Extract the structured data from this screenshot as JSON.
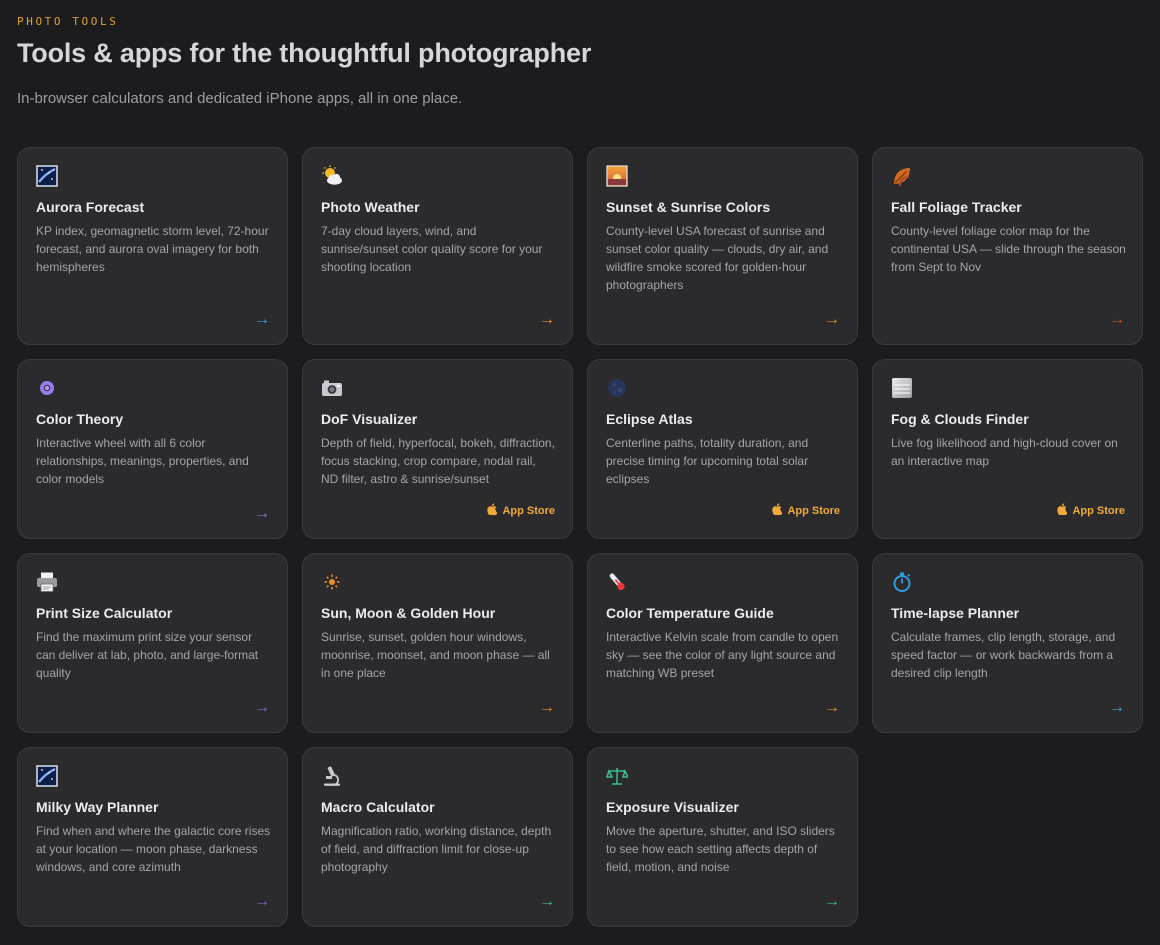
{
  "header": {
    "eyebrow": "PHOTO TOOLS",
    "title": "Tools & apps for the thoughtful photographer",
    "subtitle": "In-browser calculators and dedicated iPhone apps, all in one place."
  },
  "colors": {
    "accent": "#e0a030",
    "background": "#1c1c1e",
    "card": "#2b2b2e",
    "app_store": "#f0a93a"
  },
  "cards": [
    {
      "title": "Aurora Forecast",
      "description": "KP index, geomagnetic storm level, 72-hour forecast, and aurora oval imagery for both hemispheres",
      "icon": "night-sky-icon",
      "action": "arrow",
      "arrow": "→",
      "arrow_color": "#37a8d8"
    },
    {
      "title": "Photo Weather",
      "description": "7-day cloud layers, wind, and sunrise/sunset color quality score for your shooting location",
      "icon": "sun-behind-cloud-icon",
      "action": "arrow",
      "arrow": "→",
      "arrow_color": "#e8892a"
    },
    {
      "title": "Sunset & Sunrise Colors",
      "description": "County-level USA forecast of sunrise and sunset color quality — clouds, dry air, and wildfire smoke scored for golden-hour photographers",
      "icon": "sunset-picture-icon",
      "action": "arrow",
      "arrow": "→",
      "arrow_color": "#e8892a"
    },
    {
      "title": "Fall Foliage Tracker",
      "description": "County-level foliage color map for the continental USA — slide through the season from Sept to Nov",
      "icon": "fallen-leaf-icon",
      "action": "arrow",
      "arrow": "→",
      "arrow_color": "#c9502a"
    },
    {
      "title": "Color Theory",
      "description": "Interactive wheel with all 6 color relationships, meanings, properties, and color models",
      "icon": "purple-circle-icon",
      "action": "arrow",
      "arrow": "→",
      "arrow_color": "#8a7ad8"
    },
    {
      "title": "DoF Visualizer",
      "description": "Depth of field, hyperfocal, bokeh, diffraction, focus stacking, crop compare, nodal rail, ND filter, astro & sunrise/sunset",
      "icon": "camera-icon",
      "action": "app_store",
      "app_store_label": "App Store"
    },
    {
      "title": "Eclipse Atlas",
      "description": "Centerline paths, totality duration, and precise timing for upcoming total solar eclipses",
      "icon": "new-moon-icon",
      "action": "app_store",
      "app_store_label": "App Store"
    },
    {
      "title": "Fog & Clouds Finder",
      "description": "Live fog likelihood and high-cloud cover on an interactive map",
      "icon": "fog-icon",
      "action": "app_store",
      "app_store_label": "App Store"
    },
    {
      "title": "Print Size Calculator",
      "description": "Find the maximum print size your sensor can deliver at lab, photo, and large-format quality",
      "icon": "printer-icon",
      "action": "arrow",
      "arrow": "→",
      "arrow_color": "#7a6ad0"
    },
    {
      "title": "Sun, Moon & Golden Hour",
      "description": "Sunrise, sunset, golden hour windows, moonrise, moonset, and moon phase — all in one place",
      "icon": "sun-icon",
      "action": "arrow",
      "arrow": "→",
      "arrow_color": "#e8892a"
    },
    {
      "title": "Color Temperature Guide",
      "description": "Interactive Kelvin scale from candle to open sky — see the color of any light source and matching WB preset",
      "icon": "thermometer-icon",
      "action": "arrow",
      "arrow": "→",
      "arrow_color": "#e8892a"
    },
    {
      "title": "Time-lapse Planner",
      "description": "Calculate frames, clip length, storage, and speed factor — or work backwards from a desired clip length",
      "icon": "stopwatch-icon",
      "action": "arrow",
      "arrow": "→",
      "arrow_color": "#37a8d8"
    },
    {
      "title": "Milky Way Planner",
      "description": "Find when and where the galactic core rises at your location — moon phase, darkness windows, and core azimuth",
      "icon": "night-sky-icon",
      "action": "arrow",
      "arrow": "→",
      "arrow_color": "#8a5ad0"
    },
    {
      "title": "Macro Calculator",
      "description": "Magnification ratio, working distance, depth of field, and diffraction limit for close-up photography",
      "icon": "microscope-icon",
      "action": "arrow",
      "arrow": "→",
      "arrow_color": "#3ac08a"
    },
    {
      "title": "Exposure Visualizer",
      "description": "Move the aperture, shutter, and ISO sliders to see how each setting affects depth of field, motion, and noise",
      "icon": "balance-scale-icon",
      "action": "arrow",
      "arrow": "→",
      "arrow_color": "#3ac08a"
    }
  ]
}
